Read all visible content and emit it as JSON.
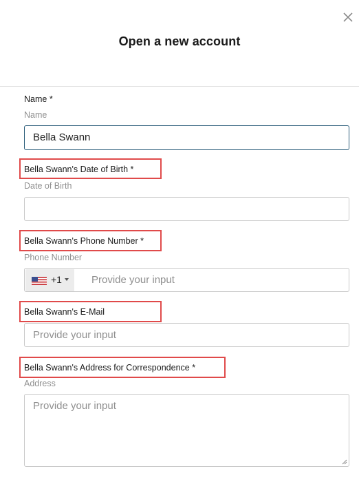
{
  "dialog": {
    "title": "Open a new account",
    "close_icon": "close-icon"
  },
  "form": {
    "name": {
      "label": "Name *",
      "sublabel": "Name",
      "value": "Bella Swann"
    },
    "dob": {
      "label": "Bella Swann's Date of Birth *",
      "sublabel": "Date of Birth",
      "value": ""
    },
    "phone": {
      "label": "Bella Swann's Phone Number *",
      "sublabel": "Phone Number",
      "country_flag": "us-flag-icon",
      "country_code": "+1",
      "placeholder": "Provide your input"
    },
    "email": {
      "label": "Bella Swann's E-Mail",
      "placeholder": "Provide your input"
    },
    "address": {
      "label": "Bella Swann's Address for Correspondence *",
      "sublabel": "Address",
      "placeholder": "Provide your input"
    }
  },
  "colors": {
    "highlight": "#e04a4a",
    "active_border": "#2b5d7a"
  }
}
